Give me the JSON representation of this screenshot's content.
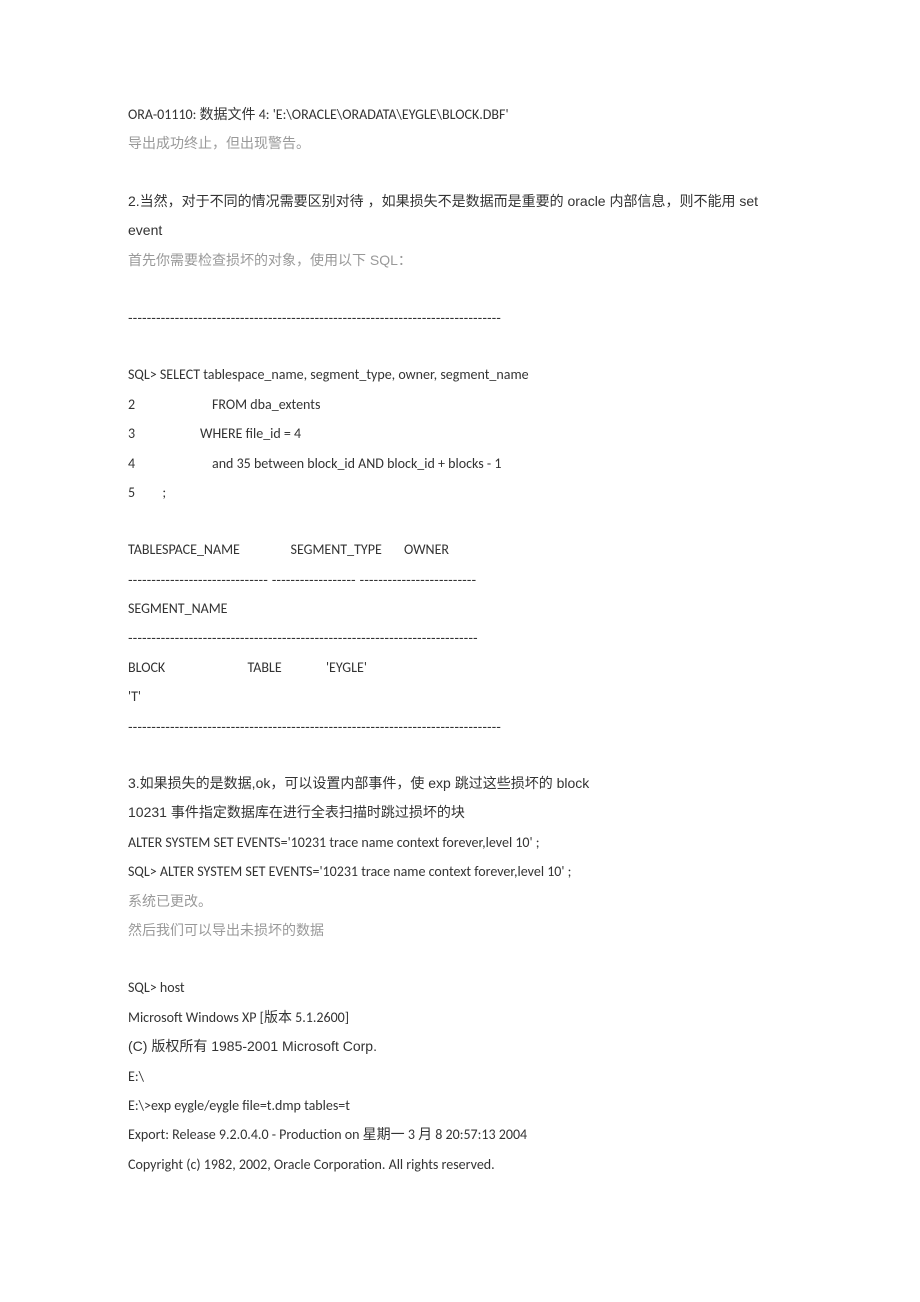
{
  "line1": "ORA-01110: 数据文件 4: 'E:\\ORACLE\\ORADATA\\EYGLE\\BLOCK.DBF'",
  "line2": "导出成功终止，但出现警告。",
  "line3a": "2.当然，对于不同的情况需要区别对待 ，如果损失不是数据而是重要的 oracle 内部信息，则不能用 set event",
  "line4": "首先你需要检查损坏的对象，使用以下 SQL：",
  "dash1": "--------------------------------------------------------------------------------",
  "sql1": "SQL> SELECT tablespace_name, segment_type, owner, segment_name",
  "sql2": "FROM dba_extents",
  "sql3": "WHERE file_id = 4",
  "sql4": "and 35 between block_id AND block_id + blocks - 1",
  "sql5": ";",
  "sqlnum2": "2",
  "sqlnum3": "3",
  "sqlnum4": "4",
  "sqlnum5": "5",
  "hdr1": "TABLESPACE_NAME                SEGMENT_TYPE       OWNER",
  "dash2": "------------------------------ ------------------ -------------------------",
  "hdr2": "SEGMENT_NAME",
  "dash3": "---------------------------------------------------------------------------",
  "row1": "BLOCK                          TABLE              'EYGLE'",
  "row2": "'T'",
  "dash4": "--------------------------------------------------------------------------------",
  "p3a": "3.如果损失的是数据,ok，可以设置内部事件，使 exp 跳过这些损坏的 block",
  "p3b": "10231 事件指定数据库在进行全表扫描时跳过损坏的块",
  "p3c": "ALTER SYSTEM SET EVENTS='10231 trace name context forever,level 10' ;",
  "p3d": "SQL> ALTER SYSTEM SET EVENTS='10231 trace name context forever,level 10' ;",
  "p3e": "系统已更改。",
  "p3f": "然后我们可以导出未损坏的数据",
  "p4a": "SQL> host",
  "p4b": "Microsoft Windows XP [版本 5.1.2600]",
  "p4c": "(C) 版权所有 1985-2001 Microsoft Corp.",
  "p4d": "E:\\",
  "p4e": "E:\\>exp eygle/eygle file=t.dmp tables=t",
  "p4f": "Export: Release 9.2.0.4.0 - Production on 星期一 3 月 8 20:57:13 2004",
  "p4g": "Copyright (c) 1982, 2002, Oracle Corporation. All rights reserved."
}
